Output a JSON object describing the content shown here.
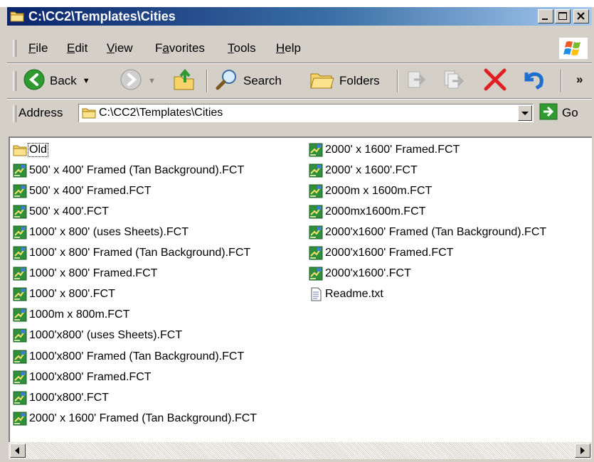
{
  "window": {
    "title": "C:\\CC2\\Templates\\Cities"
  },
  "menu": {
    "items": [
      {
        "key": "F",
        "rest": "ile"
      },
      {
        "key": "E",
        "rest": "dit"
      },
      {
        "key": "V",
        "rest": "iew"
      },
      {
        "pre": "F",
        "key": "a",
        "rest": "vorites"
      },
      {
        "key": "T",
        "rest": "ools"
      },
      {
        "key": "H",
        "rest": "elp"
      }
    ]
  },
  "toolbar": {
    "back_label": "Back",
    "search_label": "Search",
    "folders_label": "Folders",
    "overflow_label": "»"
  },
  "address": {
    "label": "Address",
    "value": "C:\\CC2\\Templates\\Cities",
    "go_label": "Go"
  },
  "files": {
    "column1": [
      {
        "name": "Old",
        "type": "folder"
      },
      {
        "name": "500' x 400' Framed (Tan Background).FCT",
        "type": "fct"
      },
      {
        "name": "500' x 400' Framed.FCT",
        "type": "fct"
      },
      {
        "name": "500' x 400'.FCT",
        "type": "fct"
      },
      {
        "name": "1000' x 800' (uses Sheets).FCT",
        "type": "fct"
      },
      {
        "name": "1000' x 800' Framed (Tan Background).FCT",
        "type": "fct"
      },
      {
        "name": "1000' x 800' Framed.FCT",
        "type": "fct"
      },
      {
        "name": "1000' x 800'.FCT",
        "type": "fct"
      },
      {
        "name": "1000m x 800m.FCT",
        "type": "fct"
      },
      {
        "name": "1000'x800' (uses Sheets).FCT",
        "type": "fct"
      },
      {
        "name": "1000'x800' Framed (Tan Background).FCT",
        "type": "fct"
      },
      {
        "name": "1000'x800' Framed.FCT",
        "type": "fct"
      },
      {
        "name": "1000'x800'.FCT",
        "type": "fct"
      },
      {
        "name": "2000' x 1600' Framed (Tan Background).FCT",
        "type": "fct"
      }
    ],
    "column2": [
      {
        "name": "2000' x 1600' Framed.FCT",
        "type": "fct"
      },
      {
        "name": "2000' x 1600'.FCT",
        "type": "fct"
      },
      {
        "name": "2000m x 1600m.FCT",
        "type": "fct"
      },
      {
        "name": "2000mx1600m.FCT",
        "type": "fct"
      },
      {
        "name": "2000'x1600' Framed (Tan Background).FCT",
        "type": "fct"
      },
      {
        "name": "2000'x1600' Framed.FCT",
        "type": "fct"
      },
      {
        "name": "2000'x1600'.FCT",
        "type": "fct"
      },
      {
        "name": "Readme.txt",
        "type": "txt"
      }
    ]
  },
  "colors": {
    "titlebar_start": "#0a246a",
    "titlebar_end": "#a6caf0",
    "chrome": "#d4d0c8",
    "back_green": "#2f9a2f",
    "delete_red": "#e02020"
  }
}
